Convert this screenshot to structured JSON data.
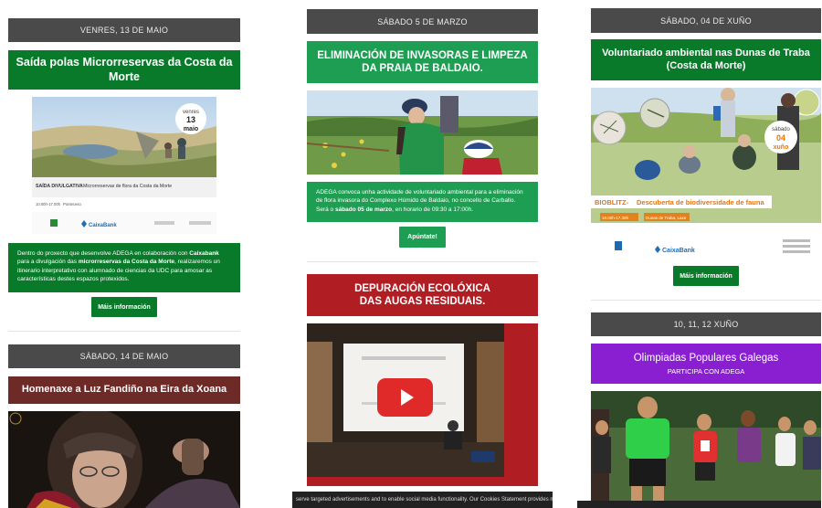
{
  "col1": {
    "event1": {
      "date": "VENRES, 13 DE MAIO",
      "title": "Saída polas Microrreservas da Costa da Morte",
      "poster": {
        "badge_line1": "venres",
        "badge_day": "13",
        "badge_line2": "maio",
        "caption_bold": "SAÍDA DIVULGATIVA",
        "caption": "Microrreservas de flora da Costa da Morte",
        "time": "10.00h-17.00h",
        "place": "Ponteceso",
        "sponsor": "CaixaBank"
      },
      "description_prefix": "Dentro do proxecto que desenvolve ADEGA en colaboración con ",
      "description_brand": "Caixabank",
      "description_mid": " para a divulgación das ",
      "description_bold": "microrreservas da Costa da Morte",
      "description_suffix": ", realizaremos un itinerario interpretativo con alumnado de ciencias da UDC para amosar as características destes espazos protexidos.",
      "button": "Máis información"
    },
    "event2": {
      "date": "SÁBADO, 14 DE MAIO",
      "title": "Homenaxe a Luz Fandiño na Eira da Xoana"
    }
  },
  "col2": {
    "event1": {
      "date": "SÁBADO 5 DE MARZO",
      "title": "ELIMINACIÓN DE INVASORAS E LIMPEZA DA PRAIA DE BALDAIO.",
      "description_prefix": "ADEGA convoca unha actividade de voluntariado ambiental para a eliminación de flora invasora do Complexo Húmido de Baldaio, no concello de Carballo. Será o ",
      "description_bold": "sábado 05 de marzo",
      "description_suffix": ", en horario de 09:30 a 17:00h.",
      "button": "Apúntate!"
    },
    "event2": {
      "title_line1": "DEPURACIÓN ECOLÓXICA",
      "title_line2": "DAS AUGAS RESIDUAIS."
    },
    "cookie_text": "serve targeted advertisements and to enable social media functionality. Our Cookies Statement provides more information a"
  },
  "col3": {
    "event1": {
      "date": "SÁBADO, 04 DE XUÑO",
      "title": "Voluntariado ambiental nas Dunas de Traba (Costa da Morte)",
      "poster": {
        "badge_line1": "sábado",
        "badge_day": "04",
        "badge_line2": "xuño",
        "banner_bold": "BIOBLITZ-",
        "banner": "Descuberta de biodiversidade de fauna",
        "time": "10.00h-17.30h",
        "place": "Dunas de Traba, Laxe",
        "sponsor": "CaixaBank"
      },
      "button": "Máis información"
    },
    "event2": {
      "date": "10, 11, 12 XUÑO",
      "title": "Olimpiadas Populares Galegas",
      "subtitle": "PARTICIPA CON ADEGA"
    }
  },
  "colors": {
    "date_bar": "#4a4a4a",
    "dark_green": "#087a2a",
    "light_green": "#1e9e52",
    "red": "#b01e24",
    "maroon": "#6e2a27",
    "purple": "#8a1fd1",
    "orange_badge": "#e8740c"
  },
  "icons": [
    "play-icon",
    "caixabank-star-icon"
  ]
}
